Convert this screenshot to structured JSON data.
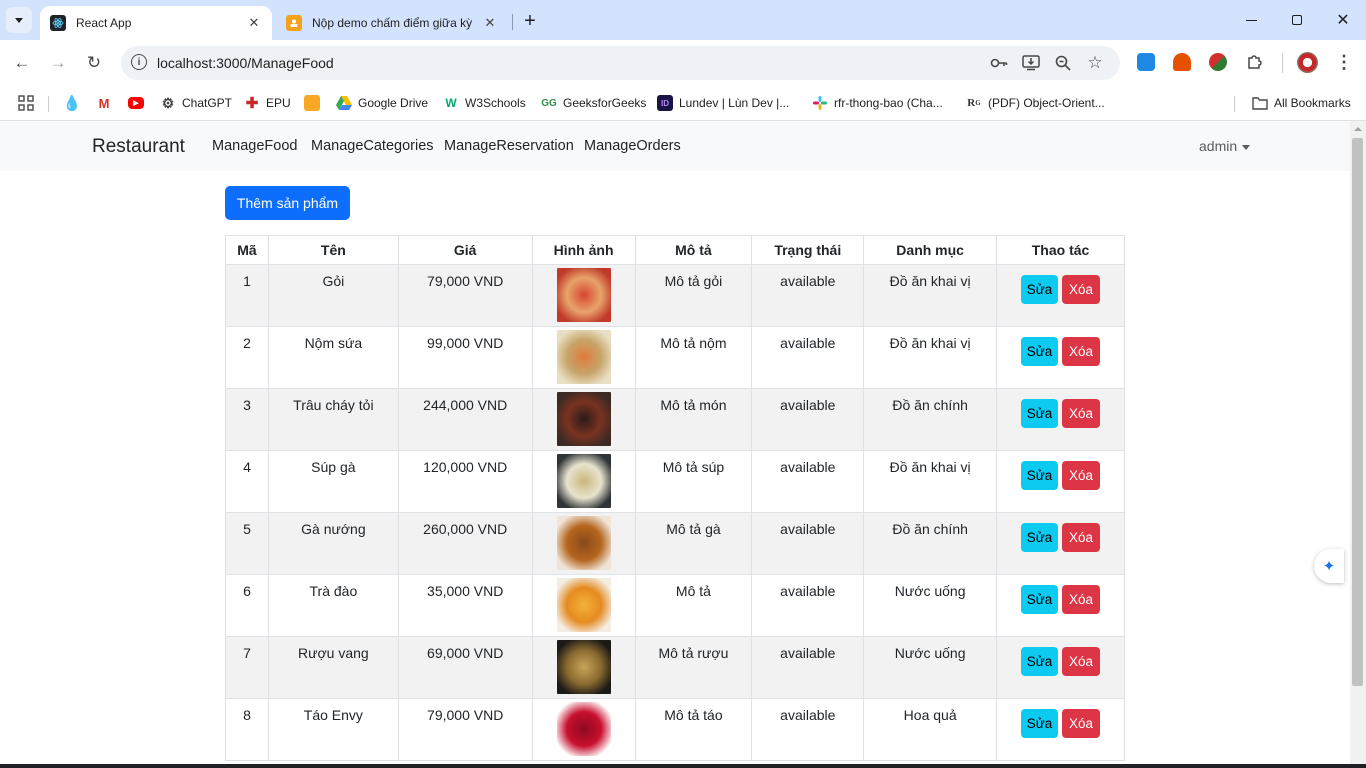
{
  "browser": {
    "tabs": [
      {
        "title": "React App",
        "active": true,
        "icon": "react-icon"
      },
      {
        "title": "Nộp demo chấm điểm giữa kỳ",
        "active": false,
        "icon": "classroom-icon"
      }
    ],
    "url": "localhost:3000/ManageFood",
    "bookmarks": [
      {
        "label": ""
      },
      {
        "label": ""
      },
      {
        "label": ""
      },
      {
        "label": "ChatGPT"
      },
      {
        "label": "EPU"
      },
      {
        "label": ""
      },
      {
        "label": "Google Drive"
      },
      {
        "label": "W3Schools"
      },
      {
        "label": "GeeksforGeeks"
      },
      {
        "label": "Lundev | Lùn Dev |..."
      },
      {
        "label": "rfr-thong-bao (Cha..."
      },
      {
        "label": "(PDF) Object-Orient..."
      }
    ],
    "all_bookmarks": "All Bookmarks"
  },
  "navbar": {
    "brand": "Restaurant",
    "links": [
      "ManageFood",
      "ManageCategories",
      "ManageReservation",
      "ManageOrders"
    ],
    "user": "admin"
  },
  "add_button": "Thêm sản phẩm",
  "table": {
    "headers": [
      "Mã",
      "Tên",
      "Giá",
      "Hình ảnh",
      "Mô tả",
      "Trạng thái",
      "Danh mục",
      "Thao tác"
    ],
    "edit_label": "Sửa",
    "delete_label": "Xóa",
    "rows": [
      {
        "id": "1",
        "name": "Gỏi",
        "price": "79,000 VND",
        "description": "Mô tả gỏi",
        "status": "available",
        "category": "Đồ ăn khai vị",
        "image_colors": [
          "#c0392b",
          "#e8a36b",
          "#d64531"
        ]
      },
      {
        "id": "2",
        "name": "Nộm sứa",
        "price": "99,000 VND",
        "description": "Mô tả nộm",
        "status": "available",
        "category": "Đồ ăn khai vị",
        "image_colors": [
          "#e9dfc4",
          "#c7a56a",
          "#e07a3b"
        ]
      },
      {
        "id": "3",
        "name": "Trâu cháy tỏi",
        "price": "244,000 VND",
        "description": "Mô tả món",
        "status": "available",
        "category": "Đồ ăn chính",
        "image_colors": [
          "#3b2a24",
          "#7a3220",
          "#2b1d18"
        ]
      },
      {
        "id": "4",
        "name": "Súp gà",
        "price": "120,000 VND",
        "description": "Mô tả súp",
        "status": "available",
        "category": "Đồ ăn khai vị",
        "image_colors": [
          "#2f3437",
          "#e8e3cf",
          "#c9b77a"
        ]
      },
      {
        "id": "5",
        "name": "Gà nướng",
        "price": "260,000 VND",
        "description": "Mô tả gà",
        "status": "available",
        "category": "Đồ ăn chính",
        "image_colors": [
          "#efe4d6",
          "#b5651d",
          "#8a4a1a"
        ]
      },
      {
        "id": "6",
        "name": "Trà đào",
        "price": "35,000 VND",
        "description": "Mô tả",
        "status": "available",
        "category": "Nước uống",
        "image_colors": [
          "#f4ede2",
          "#e58a1f",
          "#f2b23a"
        ]
      },
      {
        "id": "7",
        "name": "Rượu vang",
        "price": "69,000 VND",
        "description": "Mô tả rượu",
        "status": "available",
        "category": "Nước uống",
        "image_colors": [
          "#1b1a17",
          "#8a6a2f",
          "#c9a45a"
        ]
      },
      {
        "id": "8",
        "name": "Táo Envy",
        "price": "79,000 VND",
        "description": "Mô tả táo",
        "status": "available",
        "category": "Hoa quả",
        "image_colors": [
          "#ffffff",
          "#c8102e",
          "#8e0a1f"
        ]
      }
    ]
  },
  "colors": {
    "primary": "#0d6efd",
    "info": "#0dcaf0",
    "danger": "#dc3545",
    "navbar_bg": "#f8f9fa",
    "tab_strip": "#d3e3fd"
  }
}
